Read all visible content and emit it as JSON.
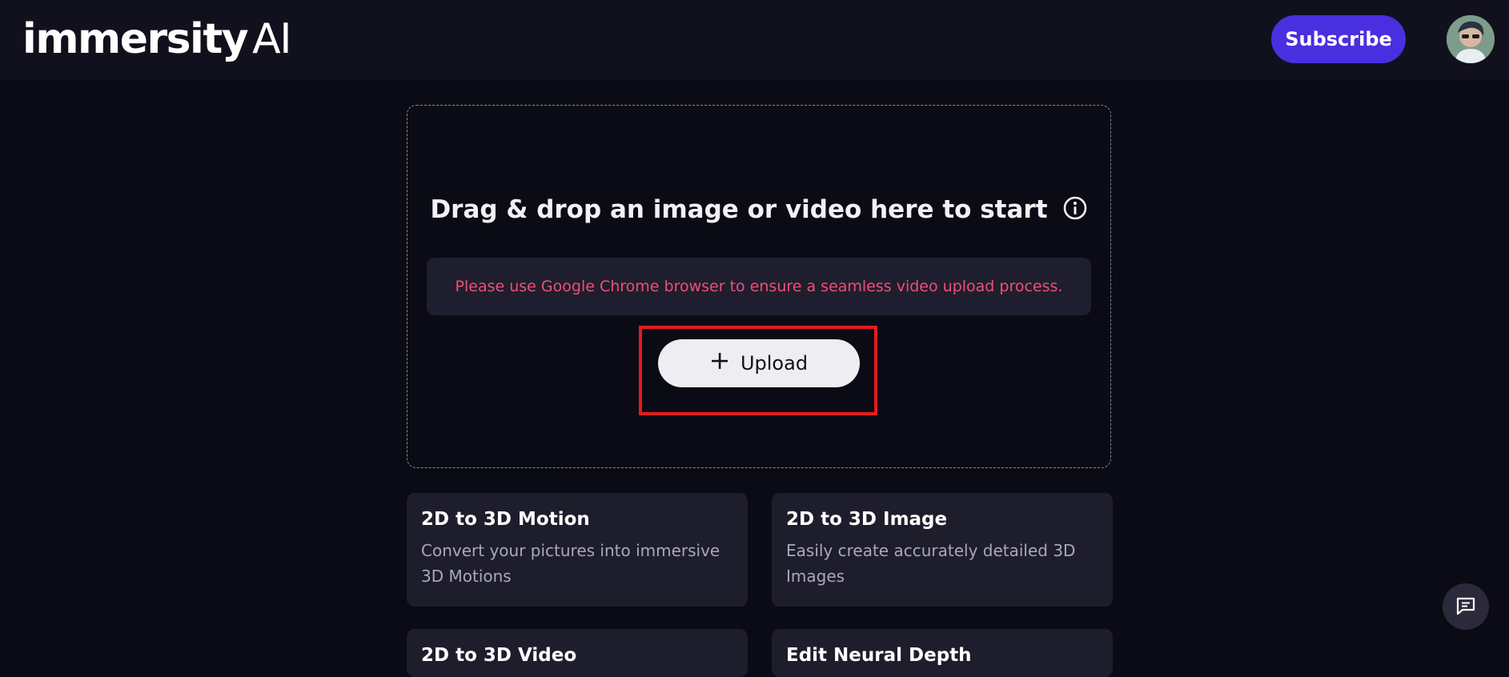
{
  "header": {
    "logo_main": "immersity",
    "logo_suffix": "AI",
    "subscribe_label": "Subscribe"
  },
  "dropzone": {
    "title": "Drag & drop an image or video here to start",
    "notice": "Please use Google Chrome browser to ensure a seamless video upload process.",
    "upload_label": "Upload"
  },
  "cards": [
    {
      "title": "2D to 3D Motion",
      "description_line1": "Convert your pictures into immersive",
      "description_line2": "3D Motions"
    },
    {
      "title": "2D to 3D Image",
      "description_line1": "Easily create accurately detailed 3D",
      "description_line2": "Images"
    },
    {
      "title": "2D to 3D Video"
    },
    {
      "title": "Edit Neural Depth"
    }
  ],
  "icons": {
    "info": "info-circle-icon",
    "plus": "plus-icon",
    "chat": "chat-icon"
  },
  "colors": {
    "background": "#0b0b15",
    "header": "#11111d",
    "accent": "#4a2fe0",
    "notice_text": "#ee4f78",
    "highlight": "#e51c1c",
    "card": "#1e1d2c"
  }
}
